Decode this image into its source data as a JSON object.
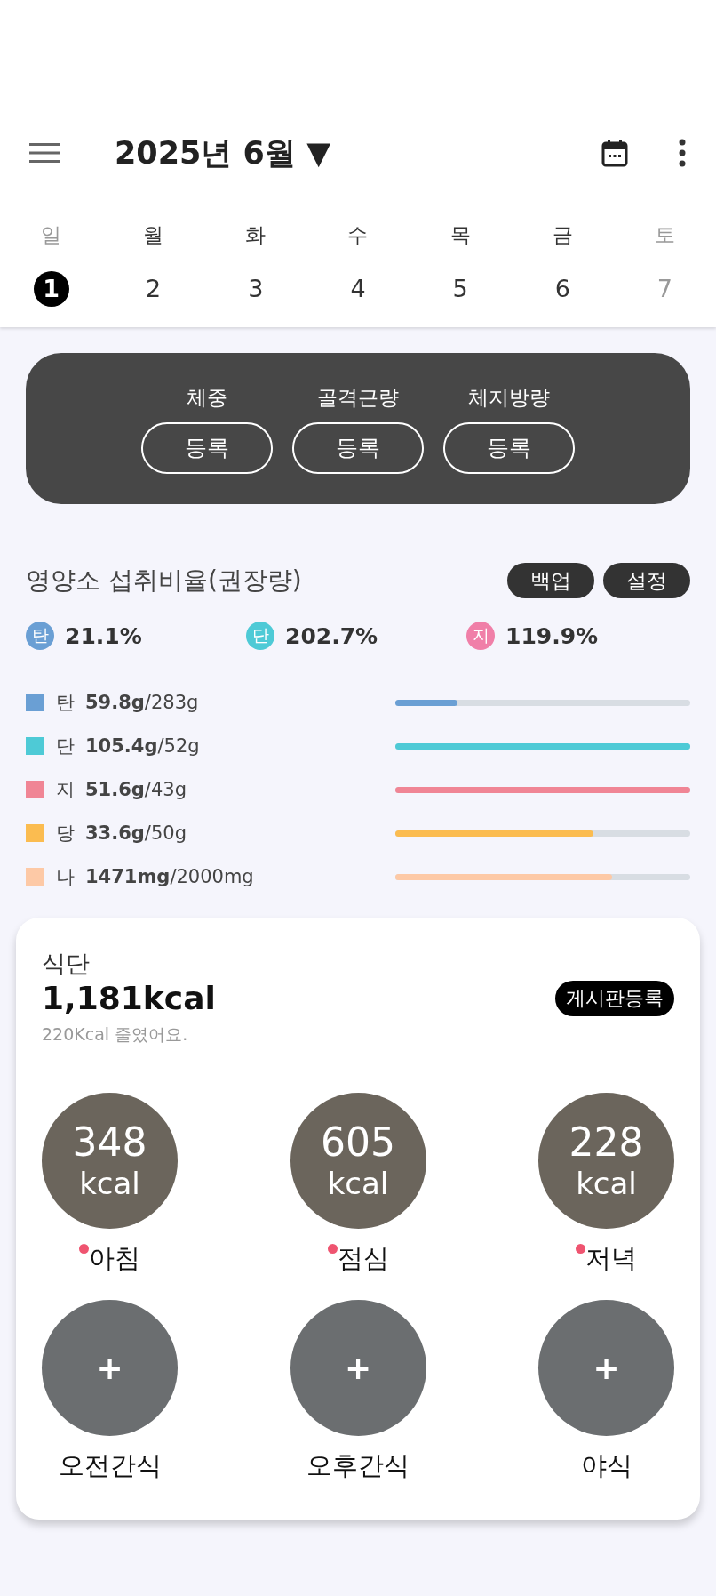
{
  "header": {
    "title": "2025년 6월",
    "dropdown": "▼"
  },
  "week": [
    {
      "day": "일",
      "date": "1",
      "muted": true,
      "selected": true
    },
    {
      "day": "월",
      "date": "2",
      "muted": false,
      "selected": false
    },
    {
      "day": "화",
      "date": "3",
      "muted": false,
      "selected": false
    },
    {
      "day": "수",
      "date": "4",
      "muted": false,
      "selected": false
    },
    {
      "day": "목",
      "date": "5",
      "muted": false,
      "selected": false
    },
    {
      "day": "금",
      "date": "6",
      "muted": false,
      "selected": false
    },
    {
      "day": "토",
      "date": "7",
      "muted": true,
      "selected": false
    }
  ],
  "body_panel": [
    {
      "label": "체중",
      "button": "등록"
    },
    {
      "label": "골격근량",
      "button": "등록"
    },
    {
      "label": "체지방량",
      "button": "등록"
    }
  ],
  "nutrients": {
    "title": "영양소 섭취비율(권장량)",
    "buttons": [
      "백업",
      "설정"
    ],
    "ratios": [
      {
        "badge": "탄",
        "value": "21.1%",
        "color": "#6a9fd4"
      },
      {
        "badge": "단",
        "value": "202.7%",
        "color": "#4ecad6"
      },
      {
        "badge": "지",
        "value": "119.9%",
        "color": "#f07fa8"
      }
    ],
    "bars": [
      {
        "label": "탄",
        "amount": "59.8g",
        "target": "/283g",
        "color": "#6a9fd4",
        "level": 0.211
      },
      {
        "label": "단",
        "amount": "105.4g",
        "target": "/52g",
        "color": "#4ecad6",
        "level": 1
      },
      {
        "label": "지",
        "amount": "51.6g",
        "target": "/43g",
        "color": "#f08595",
        "level": 1
      },
      {
        "label": "당",
        "amount": "33.6g",
        "target": "/50g",
        "color": "#fbbc50",
        "level": 0.672
      },
      {
        "label": "나",
        "amount": "1471mg",
        "target": "/2000mg",
        "color": "#fdc9a6",
        "level": 0.7355
      }
    ]
  },
  "diet": {
    "title": "식단",
    "total": "1,181kcal",
    "note": "220Kcal 줄였어요.",
    "post_button": "게시판등록",
    "meals": [
      {
        "kind": "photo",
        "value": "348",
        "unit": "kcal",
        "label": "아침",
        "marked": true
      },
      {
        "kind": "photo",
        "value": "605",
        "unit": "kcal",
        "label": "점심",
        "marked": true
      },
      {
        "kind": "photo",
        "value": "228",
        "unit": "kcal",
        "label": "저녁",
        "marked": true
      },
      {
        "kind": "add",
        "symbol": "+",
        "label": "오전간식"
      },
      {
        "kind": "add",
        "symbol": "+",
        "label": "오후간식"
      },
      {
        "kind": "add",
        "symbol": "+",
        "label": "야식"
      }
    ]
  }
}
